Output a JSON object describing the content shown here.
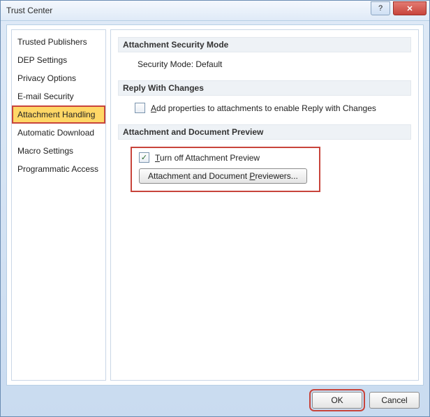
{
  "window": {
    "title": "Trust Center"
  },
  "sidebar": {
    "items": [
      {
        "label": "Trusted Publishers"
      },
      {
        "label": "DEP Settings"
      },
      {
        "label": "Privacy Options"
      },
      {
        "label": "E-mail Security"
      },
      {
        "label": "Attachment Handling",
        "selected": true,
        "highlight": true
      },
      {
        "label": "Automatic Download"
      },
      {
        "label": "Macro Settings"
      },
      {
        "label": "Programmatic Access"
      }
    ]
  },
  "sections": {
    "security_mode": {
      "heading": "Attachment Security Mode",
      "value_label": "Security Mode: Default"
    },
    "reply_changes": {
      "heading": "Reply With Changes",
      "checkbox_pre": "A",
      "checkbox_rest": "dd properties to attachments to enable Reply with Changes",
      "checked": false
    },
    "preview": {
      "heading": "Attachment and Document Preview",
      "turnoff_pre": "T",
      "turnoff_rest": "urn off Attachment Preview",
      "turnoff_checked": true,
      "button_pre": "Attachment and Document ",
      "button_ul": "P",
      "button_rest": "reviewers...",
      "highlight": true
    }
  },
  "footer": {
    "ok": "OK",
    "cancel": "Cancel",
    "ok_highlight": true
  }
}
